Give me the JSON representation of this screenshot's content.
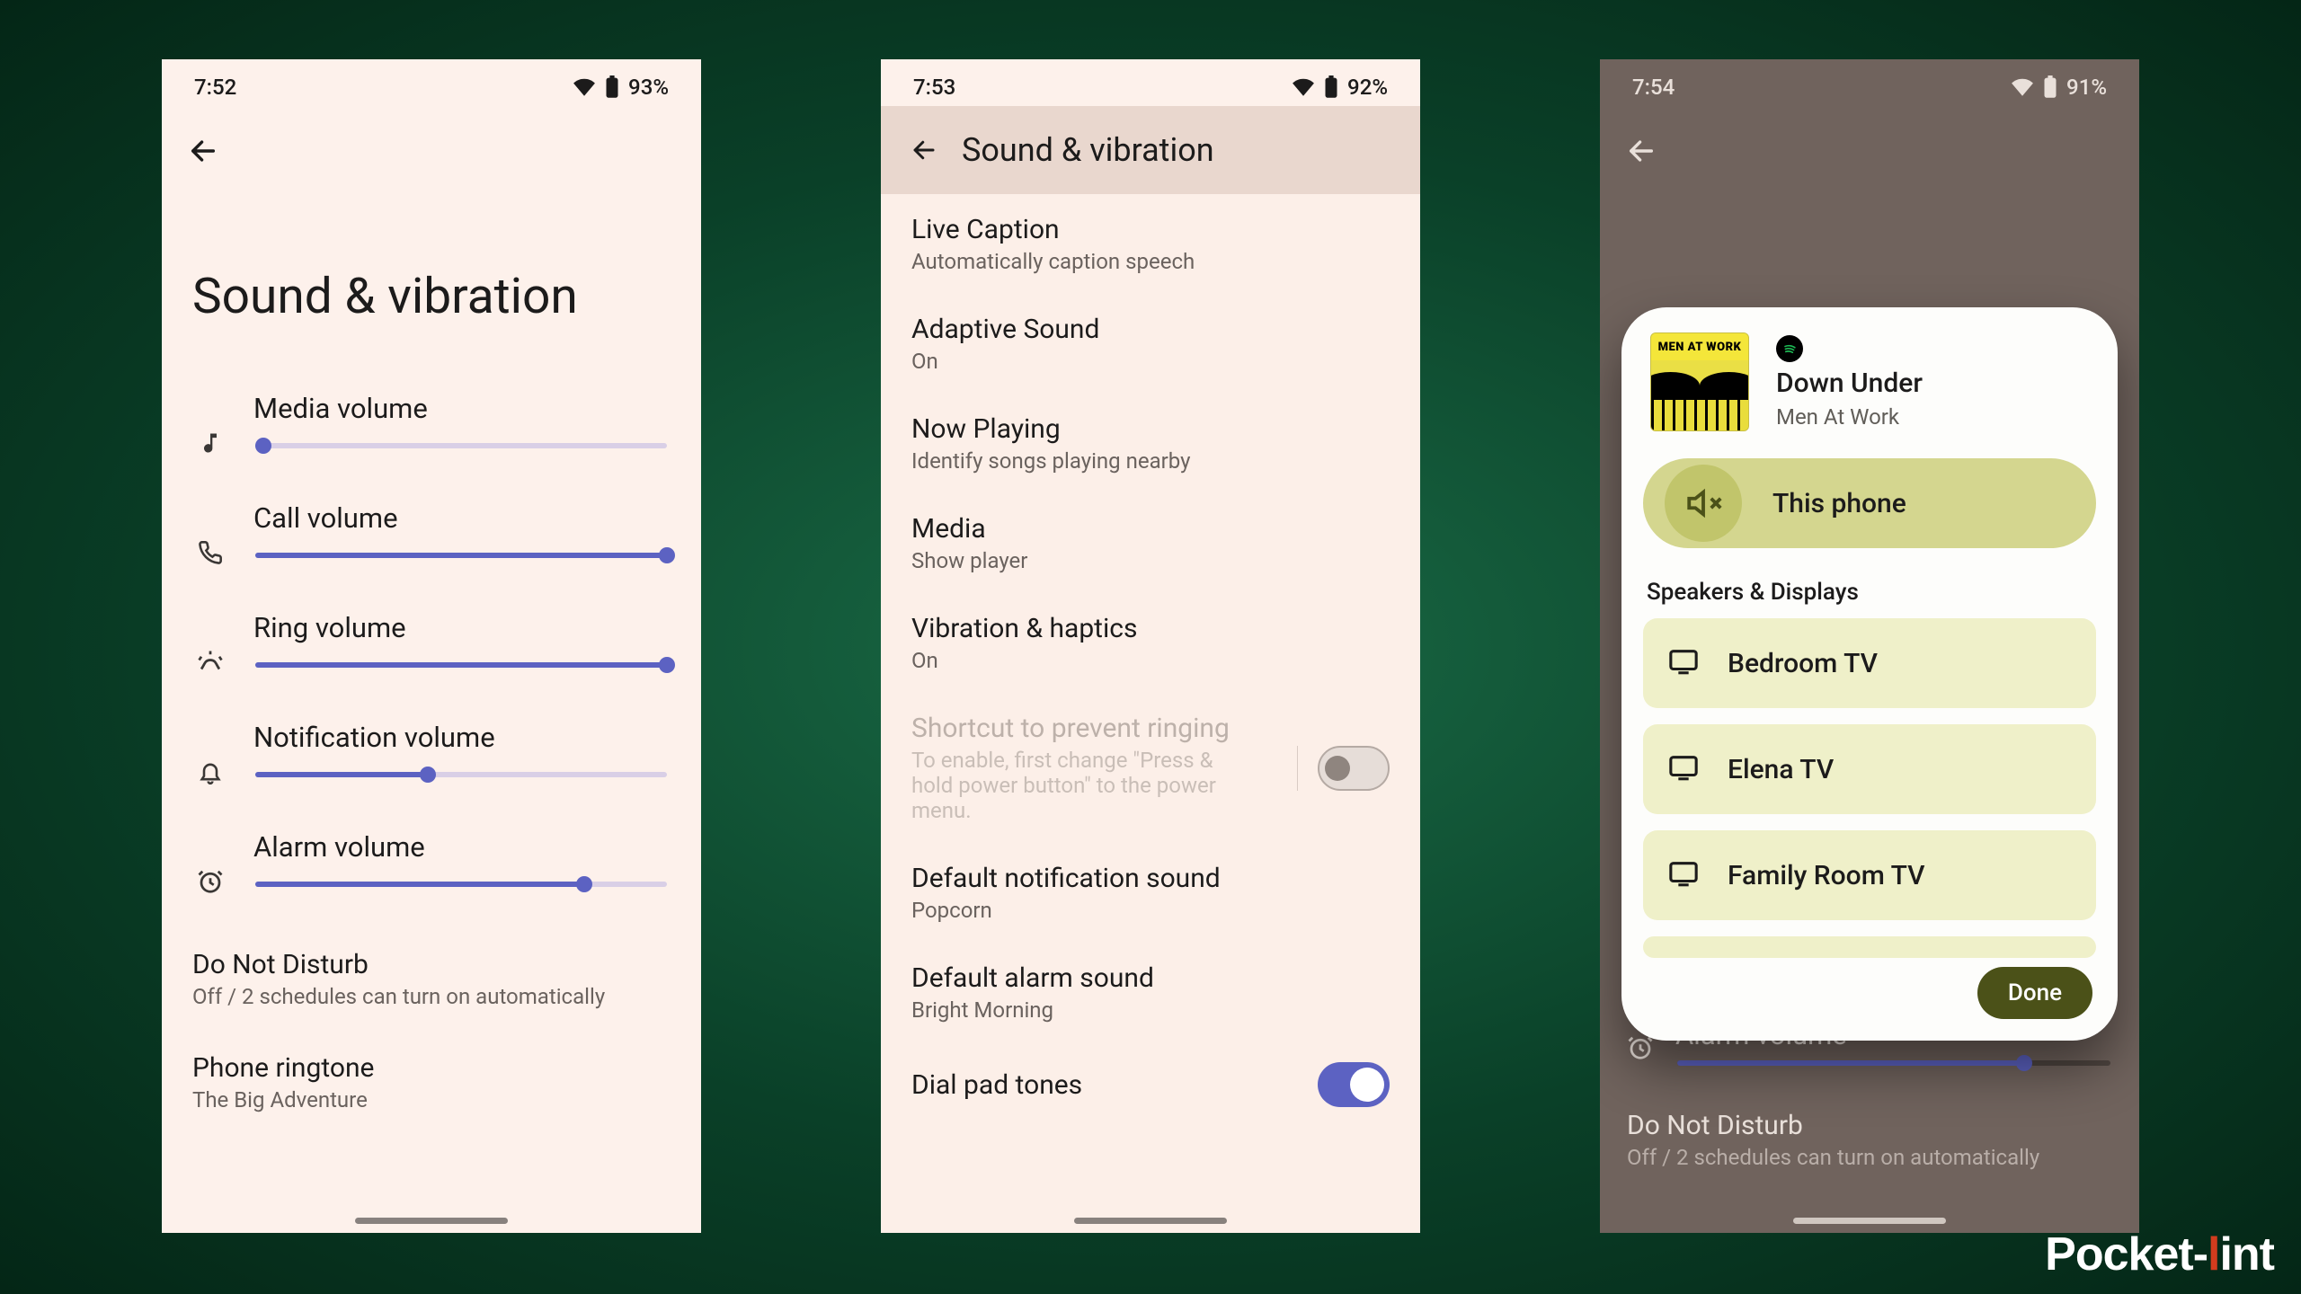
{
  "watermark": {
    "pre": "Pocket",
    "accent": "l",
    "post": "int"
  },
  "phone1": {
    "status": {
      "time": "7:52",
      "battery": "93%"
    },
    "title": "Sound & vibration",
    "sliders": {
      "media": {
        "label": "Media volume",
        "value": 2
      },
      "call": {
        "label": "Call volume",
        "value": 100
      },
      "ring": {
        "label": "Ring volume",
        "value": 100
      },
      "notification": {
        "label": "Notification volume",
        "value": 42
      },
      "alarm": {
        "label": "Alarm volume",
        "value": 80
      }
    },
    "dnd": {
      "label": "Do Not Disturb",
      "sub": "Off / 2 schedules can turn on automatically"
    },
    "ringtone": {
      "label": "Phone ringtone",
      "sub": "The Big Adventure"
    }
  },
  "phone2": {
    "status": {
      "time": "7:53",
      "battery": "92%"
    },
    "title": "Sound & vibration",
    "items": {
      "live_caption": {
        "label": "Live Caption",
        "sub": "Automatically caption speech"
      },
      "adaptive": {
        "label": "Adaptive Sound",
        "sub": "On"
      },
      "now_playing": {
        "label": "Now Playing",
        "sub": "Identify songs playing nearby"
      },
      "media": {
        "label": "Media",
        "sub": "Show player"
      },
      "vibration": {
        "label": "Vibration & haptics",
        "sub": "On"
      },
      "shortcut_ring": {
        "label": "Shortcut to prevent ringing",
        "sub": "To enable, first change \"Press & hold power button\" to the power menu.",
        "enabled": false
      },
      "notif_sound": {
        "label": "Default notification sound",
        "sub": "Popcorn"
      },
      "alarm_sound": {
        "label": "Default alarm sound",
        "sub": "Bright Morning"
      },
      "dial_tones": {
        "label": "Dial pad tones",
        "enabled": true
      }
    }
  },
  "phone3": {
    "status": {
      "time": "7:54",
      "battery": "91%"
    },
    "sheet": {
      "album_banner": "MEN AT WORK",
      "track": "Down Under",
      "artist": "Men At Work",
      "this_phone": "This phone",
      "section": "Speakers & Displays",
      "devices": {
        "0": "Bedroom TV",
        "1": "Elena TV",
        "2": "Family Room TV"
      },
      "done": "Done"
    },
    "bg": {
      "alarm": {
        "label": "Alarm volume",
        "value": 80
      },
      "dnd": {
        "label": "Do Not Disturb",
        "sub": "Off / 2 schedules can turn on automatically"
      }
    }
  }
}
